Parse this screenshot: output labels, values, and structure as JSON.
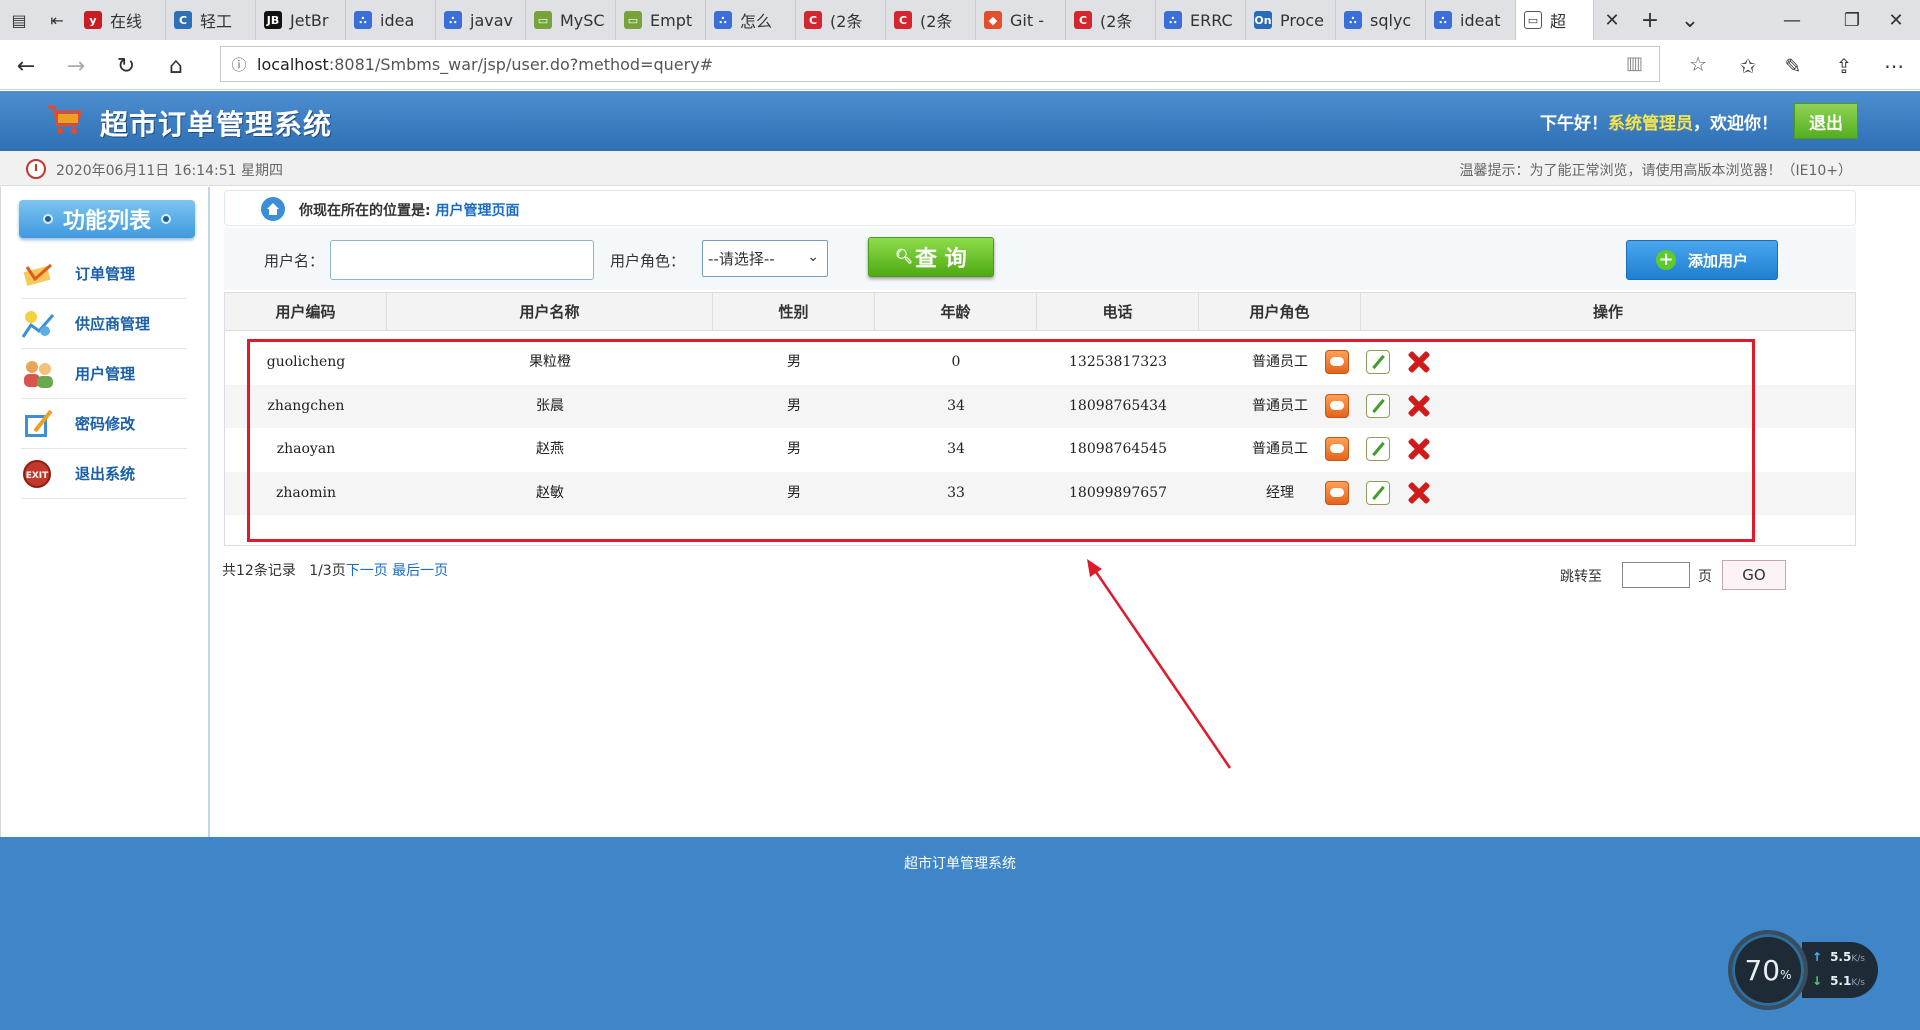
{
  "browser": {
    "tabs": [
      {
        "label": "在线",
        "color": "#c71d23",
        "glyph": "y"
      },
      {
        "label": "轻工",
        "color": "#2f6fb4",
        "glyph": "C"
      },
      {
        "label": "JetBr",
        "color": "#111111",
        "glyph": "JB"
      },
      {
        "label": "idea",
        "color": "#3a6fd8",
        "glyph": "∴"
      },
      {
        "label": "javav",
        "color": "#3a6fd8",
        "glyph": "∴"
      },
      {
        "label": "MySC",
        "color": "#78a33b",
        "glyph": "▭"
      },
      {
        "label": "Empt",
        "color": "#78a33b",
        "glyph": "▭"
      },
      {
        "label": "怎么",
        "color": "#3a6fd8",
        "glyph": "∴"
      },
      {
        "label": "(2条",
        "color": "#d4262f",
        "glyph": "C"
      },
      {
        "label": "(2条",
        "color": "#d4262f",
        "glyph": "C"
      },
      {
        "label": "Git -",
        "color": "#e0502c",
        "glyph": "◆"
      },
      {
        "label": "(2条",
        "color": "#d4262f",
        "glyph": "C"
      },
      {
        "label": "ERRC",
        "color": "#3a6fd8",
        "glyph": "∴"
      },
      {
        "label": "Proce",
        "color": "#2a6ab8",
        "glyph": "On"
      },
      {
        "label": "sqlyc",
        "color": "#3a6fd8",
        "glyph": "∴"
      },
      {
        "label": "ideat",
        "color": "#3a6fd8",
        "glyph": "∴"
      }
    ],
    "active_tab_label": "超",
    "url_host": "localhost",
    "url_rest": ":8081/Smbms_war/jsp/user.do?method=query#"
  },
  "header": {
    "title": "超市订单管理系统",
    "greeting": "下午好！",
    "role": "系统管理员",
    "welcome": "，欢迎你！",
    "logout_label": "退出"
  },
  "info": {
    "datetime": "2020年06月11日 16:14:51 星期四",
    "tip": "温馨提示：为了能正常浏览，请使用高版本浏览器！（IE10+）"
  },
  "sidebar": {
    "title": "功能列表",
    "items": [
      {
        "label": "订单管理",
        "icon": "order-icon"
      },
      {
        "label": "供应商管理",
        "icon": "provider-icon"
      },
      {
        "label": "用户管理",
        "icon": "users-icon"
      },
      {
        "label": "密码修改",
        "icon": "password-icon"
      },
      {
        "label": "退出系统",
        "icon": "exit-icon"
      }
    ]
  },
  "breadcrumb": {
    "prefix": "你现在所在的位置是:",
    "current": "用户管理页面"
  },
  "search": {
    "name_label": "用户名：",
    "name_value": "",
    "role_label": "用户角色：",
    "role_selected": "--请选择--",
    "query_label": "查 询",
    "add_label": "添加用户"
  },
  "table": {
    "headers": [
      "用户编码",
      "用户名称",
      "性别",
      "年龄",
      "电话",
      "用户角色",
      "操作"
    ],
    "rows": [
      [
        "guolicheng",
        "果粒橙",
        "男",
        "0",
        "13253817323",
        "普通员工"
      ],
      [
        "zhangchen",
        "张晨",
        "男",
        "34",
        "18098765434",
        "普通员工"
      ],
      [
        "zhaoyan",
        "赵燕",
        "男",
        "34",
        "18098764545",
        "普通员工"
      ],
      [
        "zhaomin",
        "赵敏",
        "男",
        "33",
        "18099897657",
        "经理"
      ]
    ]
  },
  "pager": {
    "total": "共12条记录",
    "page": "1/3页",
    "next": "下一页",
    "last": "最后一页",
    "jump_label": "跳转至",
    "jump_unit": "页",
    "go_label": "GO"
  },
  "footer": {
    "text": "超市订单管理系统"
  },
  "net_widget": {
    "percent": "70",
    "percent_unit": "%",
    "up": "5.5",
    "down": "5.1",
    "unit": "K/s"
  },
  "colors": {
    "header_blue": "#2f6fb4",
    "footer_blue": "#3e86c8",
    "highlight_red": "#e0192b",
    "query_green": "#4eaa12",
    "link_blue": "#1a6cc0"
  }
}
